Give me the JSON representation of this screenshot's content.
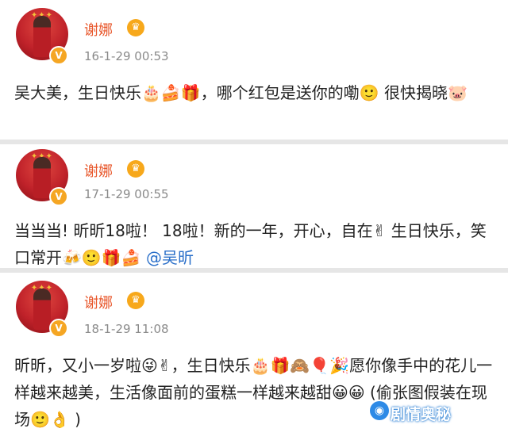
{
  "posts": [
    {
      "name": "谢娜",
      "time": "16-1-29 00:53",
      "text": "吴大美，生日快乐🎂🍰🎁，哪个红包是送你的嘞🙂 很快揭晓🐷"
    },
    {
      "name": "谢娜",
      "time": "17-1-29 00:55",
      "text": "当当当! 昕昕18啦！ 18啦！新的一年，开心，自在✌ 生日快乐，笑口常开🍻🙂🎁🍰",
      "mention": " @吴昕"
    },
    {
      "name": "谢娜",
      "time": "18-1-29 11:08",
      "text": "昕昕，又小一岁啦😜✌，生日快乐🎂🎁🙈🎈🎉愿你像手中的花儿一样越来越美，生活像面前的蛋糕一样越来越甜😀😀 (偷张图假装在现场🙂👌 )"
    }
  ],
  "badges": {
    "verified": "V",
    "crown": "♛"
  },
  "watermark": {
    "icon": "◉",
    "text": "剧情奥秘"
  }
}
